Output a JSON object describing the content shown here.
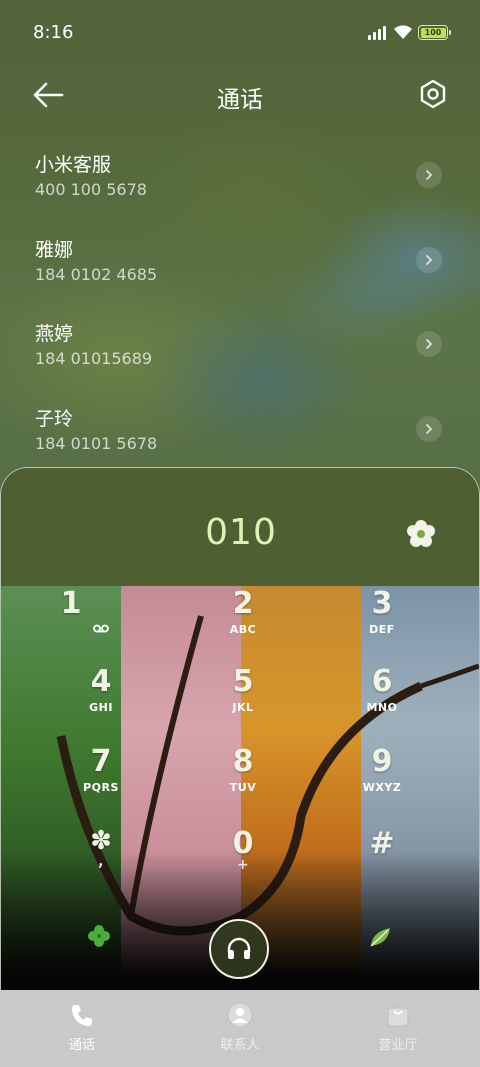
{
  "status": {
    "time": "8:16",
    "battery": "100"
  },
  "header": {
    "title": "通话"
  },
  "contacts": [
    {
      "name": "小米客服",
      "number": "400 100 5678"
    },
    {
      "name": "雅娜",
      "number": "184 0102 4685"
    },
    {
      "name": "燕婷",
      "number": "184 01015689"
    },
    {
      "name": "子玲",
      "number": "184 0101 5678"
    }
  ],
  "dialer": {
    "number": "010",
    "keys": [
      {
        "digit": "1",
        "letters": ""
      },
      {
        "digit": "2",
        "letters": "ABC"
      },
      {
        "digit": "3",
        "letters": "DEF"
      },
      {
        "digit": "4",
        "letters": "GHI"
      },
      {
        "digit": "5",
        "letters": "JKL"
      },
      {
        "digit": "6",
        "letters": "MNO"
      },
      {
        "digit": "7",
        "letters": "PQRS"
      },
      {
        "digit": "8",
        "letters": "TUV"
      },
      {
        "digit": "9",
        "letters": "WXYZ"
      },
      {
        "digit": "✽",
        "letters": ","
      },
      {
        "digit": "0",
        "letters": "+"
      },
      {
        "digit": "#",
        "letters": ""
      }
    ]
  },
  "tabs": [
    {
      "label": "通话",
      "icon": "phone-icon"
    },
    {
      "label": "联系人",
      "icon": "person-icon"
    },
    {
      "label": "营业厅",
      "icon": "bag-icon"
    }
  ],
  "colors": {
    "accent": "#e2f1b6",
    "header_bg": "#4e5f31",
    "tabbar_bg": "#c9c9c9"
  }
}
